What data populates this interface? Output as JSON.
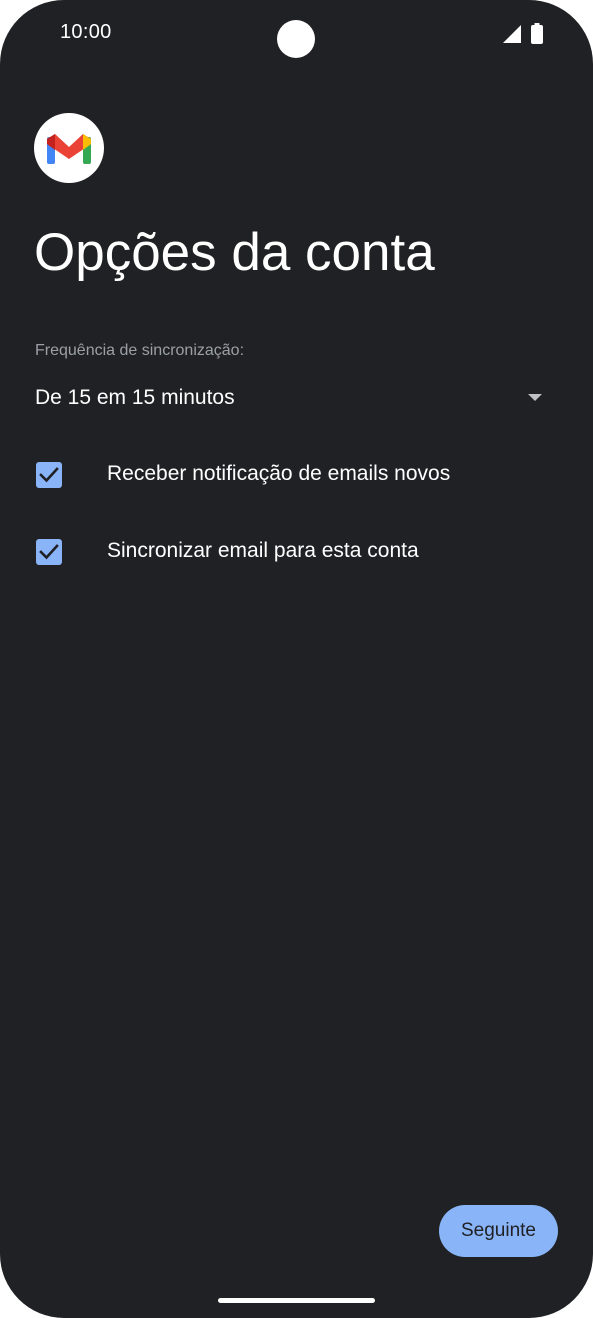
{
  "status_bar": {
    "time": "10:00",
    "icons": [
      "camera-cutout",
      "signal-icon",
      "battery-icon"
    ]
  },
  "app": {
    "logo_icon": "gmail-logo-icon",
    "title": "Opções da conta"
  },
  "sync": {
    "label": "Frequência de sincronização:",
    "selected": "De 15 em 15 minutos"
  },
  "options": [
    {
      "label": "Receber notificação de emails novos",
      "checked": true
    },
    {
      "label": "Sincronizar email para esta conta",
      "checked": true
    }
  ],
  "footer": {
    "next_label": "Seguinte"
  },
  "colors": {
    "background": "#202124",
    "accent": "#8ab4f8",
    "text": "#ffffff",
    "muted": "#9aa0a6"
  }
}
